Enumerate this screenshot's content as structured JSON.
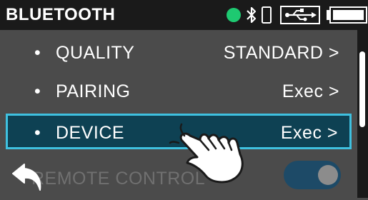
{
  "header": {
    "title": "BLUETOOTH",
    "status_icons": [
      "connection-dot-icon",
      "bluetooth-icon",
      "phone-icon",
      "usb-icon",
      "battery-icon"
    ]
  },
  "colors": {
    "accent": "#3fc1e0",
    "selected_background": "#0e4153",
    "status_green": "#1ec971",
    "header_background": "#1a1a1a",
    "list_background": "#4b4b4b",
    "disabled_text": "#707070"
  },
  "menu": {
    "bullet": "•",
    "items": [
      {
        "label": "QUALITY",
        "value": "STANDARD >"
      },
      {
        "label": "PAIRING",
        "value": "Exec >"
      },
      {
        "label": "DEVICE",
        "value": "Exec >",
        "selected": true
      },
      {
        "label": "REMOTE CONTROL",
        "toggle": "on"
      }
    ]
  },
  "icons": {
    "back": "back-arrow-icon",
    "pointer": "hand-pointer-icon"
  }
}
